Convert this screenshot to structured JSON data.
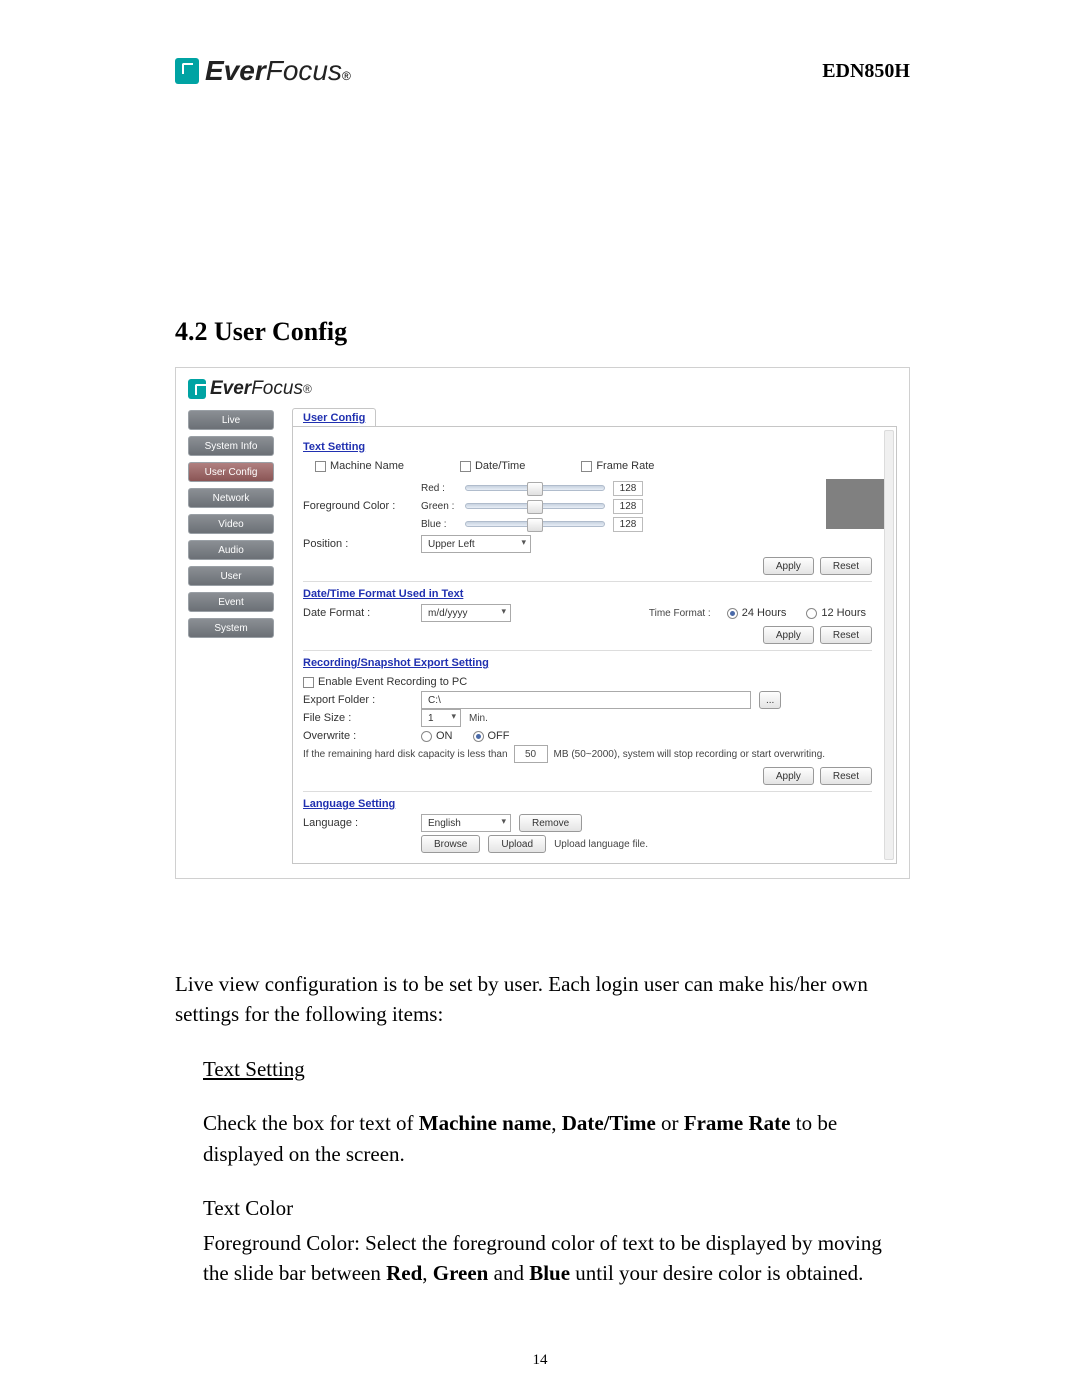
{
  "brand": {
    "ever": "Ever",
    "focus": "Focus",
    "reg": "®"
  },
  "model": "EDN850H",
  "section_title": "4.2 User Config",
  "nav": {
    "items": [
      {
        "label": "Live"
      },
      {
        "label": "System Info"
      },
      {
        "label": "User Config"
      },
      {
        "label": "Network"
      },
      {
        "label": "Video"
      },
      {
        "label": "Audio"
      },
      {
        "label": "User"
      },
      {
        "label": "Event"
      },
      {
        "label": "System"
      }
    ],
    "active_index": 2
  },
  "tab_label": "User Config",
  "groups": {
    "text_setting": {
      "title": "Text Setting",
      "machine_name": "Machine Name",
      "date_time": "Date/Time",
      "frame_rate": "Frame Rate",
      "foreground_label": "Foreground Color :",
      "sliders": {
        "red": {
          "label": "Red :",
          "value": "128"
        },
        "green": {
          "label": "Green :",
          "value": "128"
        },
        "blue": {
          "label": "Blue :",
          "value": "128"
        }
      },
      "position_label": "Position :",
      "position_value": "Upper Left"
    },
    "datetime": {
      "title": "Date/Time Format Used in Text",
      "date_format_label": "Date Format :",
      "date_format_value": "m/d/yyyy",
      "time_format_label": "Time Format :",
      "opt_24": "24 Hours",
      "opt_12": "12 Hours"
    },
    "recording": {
      "title": "Recording/Snapshot Export Setting",
      "enable_label": "Enable Event Recording to PC",
      "export_folder_label": "Export Folder :",
      "export_folder_value": "C:\\",
      "browse_btn": "...",
      "file_size_label": "File Size :",
      "file_size_value": "1",
      "file_size_unit": "Min.",
      "overwrite_label": "Overwrite :",
      "on": "ON",
      "off": "OFF",
      "remaining_pre": "If the remaining hard disk capacity is less than",
      "remaining_value": "50",
      "remaining_post": "MB (50~2000), system will stop recording or start overwriting."
    },
    "language": {
      "title": "Language Setting",
      "label": "Language :",
      "value": "English",
      "remove": "Remove",
      "browse": "Browse",
      "upload": "Upload",
      "upload_hint": "Upload language file."
    },
    "buttons": {
      "apply": "Apply",
      "reset": "Reset"
    }
  },
  "doc": {
    "p1": "Live view configuration is to be set by user. Each login user can make his/her own settings for the following items:",
    "h_textsetting": "Text Setting",
    "p2a": "Check the box for text of ",
    "p2_m": "Machine name",
    "p2_sep1": ", ",
    "p2_d": "Date/Time",
    "p2_sep2": " or ",
    "p2_f": "Frame Rate",
    "p2b": " to be displayed on the screen.",
    "h_textcolor": "Text Color",
    "p3a": "Foreground Color: Select the foreground color of text to be displayed by moving the slide bar between ",
    "p3_r": "Red",
    "p3_s1": ", ",
    "p3_g": "Green",
    "p3_s2": " and ",
    "p3_b": "Blue",
    "p3b": " until your desire color is obtained."
  },
  "page_number": "14"
}
